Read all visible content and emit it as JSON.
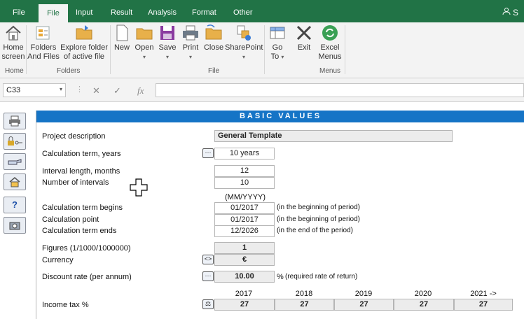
{
  "ribbon_tabs": [
    "File",
    "File",
    "Input",
    "Result",
    "Analysis",
    "Format",
    "Other"
  ],
  "user_initial": "S",
  "ribbon": {
    "home_screen": "Home screen",
    "home_line1": "Home",
    "home_line2": "screen",
    "folders_line1": "Folders",
    "folders_line2": "And Files",
    "explore_line1": "Explore folder",
    "explore_line2": "of active file",
    "new": "New",
    "open": "Open",
    "save": "Save",
    "print": "Print",
    "close": "Close",
    "sharepoint": "SharePoint",
    "goto_line1": "Go",
    "goto_line2": "To",
    "exit": "Exit",
    "excel_line1": "Excel",
    "excel_line2": "Menus",
    "group_home": "Home",
    "group_folders": "Folders",
    "group_file": "File",
    "group_menus": "Menus"
  },
  "formula_bar": {
    "cell_ref": "C33",
    "cancel": "✕",
    "enter": "✓",
    "fx": "fx",
    "value": ""
  },
  "sheet": {
    "header": "BASIC VALUES",
    "project_description_label": "Project description",
    "project_description_value": "General Template",
    "calc_term_label": "Calculation term, years",
    "calc_term_value": "10 years",
    "interval_length_label": "Interval length, months",
    "interval_length_value": "12",
    "num_intervals_label": "Number of intervals",
    "num_intervals_value": "10",
    "date_format_hint": "(MM/YYYY)",
    "term_begins_label": "Calculation term begins",
    "term_begins_value": "01/2017",
    "term_begins_note": "(in the beginning of period)",
    "calc_point_label": "Calculation point",
    "calc_point_value": "01/2017",
    "calc_point_note": "(in the beginning of period)",
    "term_ends_label": "Calculation term ends",
    "term_ends_value": "12/2026",
    "term_ends_note": "(in the end of the period)",
    "figures_label": "Figures (1/1000/1000000)",
    "figures_value": "1",
    "currency_label": "Currency",
    "currency_value": "€",
    "discount_label": "Discount rate (per annum)",
    "discount_value": "10.00",
    "discount_unit": "%",
    "discount_note": "(required rate of return)",
    "years": [
      "2017",
      "2018",
      "2019",
      "2020",
      "2021 ->"
    ],
    "income_tax_label": "Income tax %",
    "income_tax_values": [
      "27",
      "27",
      "27",
      "27",
      "27"
    ]
  }
}
